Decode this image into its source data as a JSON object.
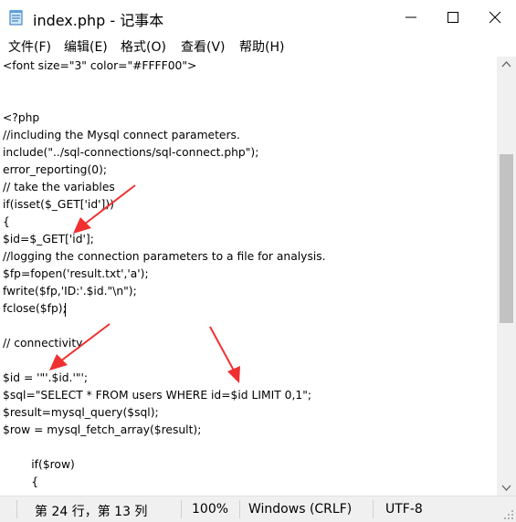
{
  "window": {
    "title": "index.php - 记事本",
    "icon": "notepad-icon",
    "controls": [
      "minimize-icon",
      "maximize-icon",
      "close-icon"
    ]
  },
  "menu": [
    {
      "label": "文件(F)"
    },
    {
      "label": "编辑(E)"
    },
    {
      "label": "格式(O)"
    },
    {
      "label": "查看(V)"
    },
    {
      "label": "帮助(H)"
    }
  ],
  "editor": {
    "lines": [
      "<font size=\"3\" color=\"#FFFF00\">",
      "",
      "",
      "<?php",
      "//including the Mysql connect parameters.",
      "include(\"../sql-connections/sql-connect.php\");",
      "error_reporting(0);",
      "// take the variables",
      "if(isset($_GET['id']))",
      "{",
      "$id=$_GET['id'];",
      "//logging the connection parameters to a file for analysis.",
      "$fp=fopen('result.txt','a');",
      "fwrite($fp,'ID:'.$id.\"\\n\");",
      "fclose($fp);",
      "",
      "// connectivity",
      "",
      "$id = '\"'.$id.'\"';",
      "$sql=\"SELECT * FROM users WHERE id=$id LIMIT 0,1\";",
      "$result=mysql_query($sql);",
      "$row = mysql_fetch_array($result);",
      "",
      "        if($row)",
      "        {"
    ]
  },
  "status": {
    "position": "第 24 行，第 13 列",
    "zoom": "100%",
    "line_ending": "Windows (CRLF)",
    "encoding": "UTF-8"
  },
  "colors": {
    "annotation_arrow": "#f03030"
  }
}
